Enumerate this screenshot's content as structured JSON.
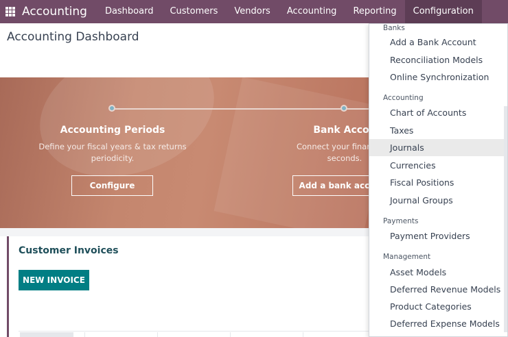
{
  "navbar": {
    "brand": "Accounting",
    "items": [
      "Dashboard",
      "Customers",
      "Vendors",
      "Accounting",
      "Reporting",
      "Configuration"
    ],
    "active": "Configuration"
  },
  "page": {
    "title": "Accounting Dashboard"
  },
  "banner": {
    "steps": [
      {
        "title": "Accounting Periods",
        "desc_line1": "Define your fiscal years & tax returns",
        "desc_line2": "periodicity.",
        "button": "Configure"
      },
      {
        "title": "Bank Accou",
        "desc_line1": "Connect your financial a",
        "desc_line2": "seconds.",
        "button": "Add a bank acco"
      }
    ]
  },
  "card": {
    "title": "Customer Invoices",
    "new_invoice": "NEW INVOICE"
  },
  "dropdown": {
    "sections": [
      {
        "label": "Banks",
        "items": [
          "Add a Bank Account",
          "Reconciliation Models",
          "Online Synchronization"
        ]
      },
      {
        "label": "Accounting",
        "items": [
          "Chart of Accounts",
          "Taxes",
          "Journals",
          "Currencies",
          "Fiscal Positions",
          "Journal Groups"
        ]
      },
      {
        "label": "Payments",
        "items": [
          "Payment Providers"
        ]
      },
      {
        "label": "Management",
        "items": [
          "Asset Models",
          "Deferred Revenue Models",
          "Product Categories",
          "Deferred Expense Models"
        ]
      }
    ],
    "highlighted": "Journals"
  },
  "colors": {
    "navbar": "#714b67",
    "primary_button": "#017e84",
    "banner": "#c4866e",
    "highlight": "#eaeaea"
  }
}
